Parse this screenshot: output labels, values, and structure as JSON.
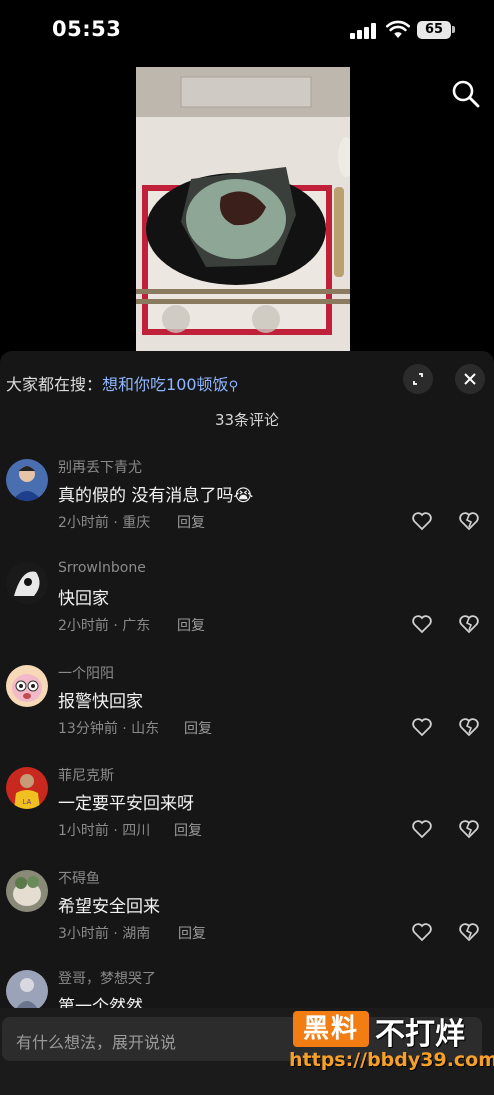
{
  "status_bar": {
    "time": "05:53",
    "battery": "65"
  },
  "trending": {
    "label": "大家都在搜：",
    "query": "想和你吃100顿饭"
  },
  "comments_header": {
    "title": "33条评论"
  },
  "comments": [
    {
      "user": "别再丢下青尤",
      "text": "真的假的  没有消息了吗😭",
      "meta": "2小时前 · 重庆",
      "reply": "回复"
    },
    {
      "user": "SrrowInbone",
      "text": "快回家",
      "meta": "2小时前 · 广东",
      "reply": "回复"
    },
    {
      "user": "一个阳阳",
      "text": "报警快回家",
      "meta": "13分钟前 · 山东",
      "reply": "回复"
    },
    {
      "user": "菲尼克斯",
      "text": "一定要平安回来呀",
      "meta": "1小时前 · 四川",
      "reply": "回复"
    },
    {
      "user": "不碍鱼",
      "text": "希望安全回来",
      "meta": "3小时前 · 湖南",
      "reply": "回复"
    },
    {
      "user": "登哥，梦想哭了",
      "text": "第一个然然"
    }
  ],
  "input": {
    "placeholder": "有什么想法，展开说说"
  },
  "watermark": {
    "badge": "黑料",
    "text": "不打烊",
    "url": "https://bbdy39.com"
  },
  "icons": {
    "search": "search-icon",
    "expand": "expand-icon",
    "close": "close-icon",
    "like": "heart-icon",
    "dislike": "broken-heart-icon"
  },
  "colors": {
    "link": "#8fb6ff",
    "panel": "#161616",
    "watermark_orange": "#f27d12"
  }
}
